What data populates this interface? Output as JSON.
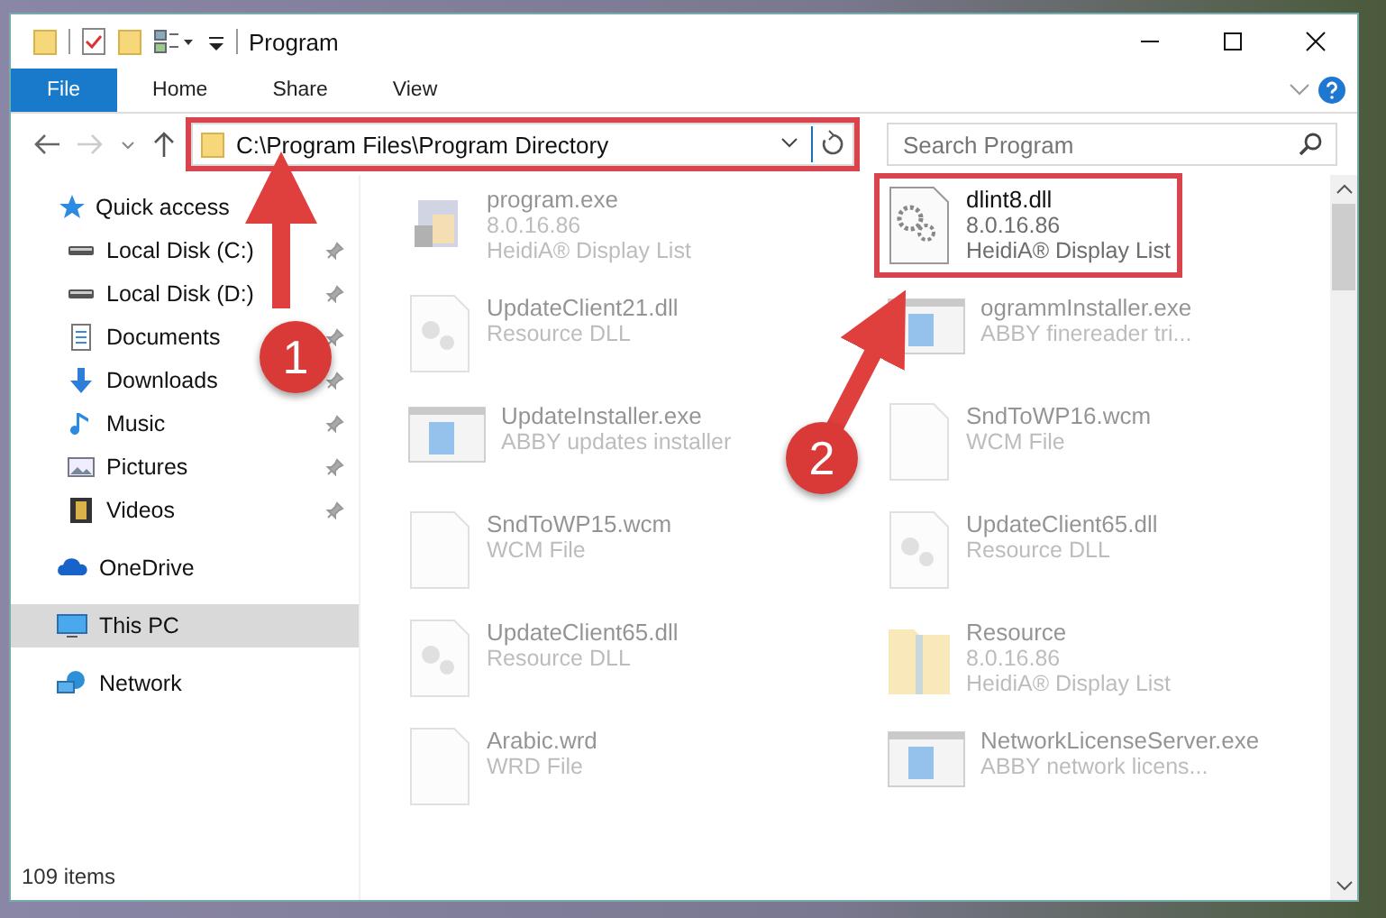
{
  "window": {
    "title": "Program"
  },
  "ribbon_tabs": [
    {
      "label": "File",
      "selected": true
    },
    {
      "label": "Home",
      "selected": false
    },
    {
      "label": "Share",
      "selected": false
    },
    {
      "label": "View",
      "selected": false
    }
  ],
  "address_bar": {
    "path": "C:\\Program Files\\Program Directory",
    "highlighted": true
  },
  "search": {
    "placeholder": "Search Program"
  },
  "sidebar": {
    "items": [
      {
        "label": "Quick access",
        "kind": "star",
        "pinned": false,
        "selected": false,
        "children": [
          {
            "label": "Local Disk (C:)",
            "kind": "drive",
            "pinned": true,
            "selected": false
          },
          {
            "label": "Local Disk (D:)",
            "kind": "drive",
            "pinned": true,
            "selected": false
          },
          {
            "label": "Documents",
            "kind": "document",
            "pinned": true,
            "selected": false
          },
          {
            "label": "Downloads",
            "kind": "download",
            "pinned": true,
            "selected": false
          },
          {
            "label": "Music",
            "kind": "music",
            "pinned": true,
            "selected": false
          },
          {
            "label": "Pictures",
            "kind": "picture",
            "pinned": true,
            "selected": false
          },
          {
            "label": "Videos",
            "kind": "video",
            "pinned": true,
            "selected": false
          }
        ]
      },
      {
        "label": "OneDrive",
        "kind": "cloud",
        "pinned": false,
        "selected": false
      },
      {
        "label": "This PC",
        "kind": "pc",
        "pinned": false,
        "selected": true
      },
      {
        "label": "Network",
        "kind": "network",
        "pinned": false,
        "selected": false
      }
    ]
  },
  "files": [
    {
      "name": "program.exe",
      "details": [
        "8.0.16.86",
        "HeidiA® Display List"
      ],
      "kind": "installer",
      "blurred": true,
      "highlighted": false
    },
    {
      "name": "dlint8.dll",
      "details": [
        "8.0.16.86",
        "HeidiA® Display List"
      ],
      "kind": "gears",
      "blurred": false,
      "highlighted": true
    },
    {
      "name": "UpdateClient21.dll",
      "details": [
        "Resource DLL"
      ],
      "kind": "dll",
      "blurred": true,
      "highlighted": false
    },
    {
      "name": "ogrammInstaller.exe",
      "details": [
        "ABBY finereader tri..."
      ],
      "kind": "window",
      "blurred": true,
      "highlighted": false
    },
    {
      "name": "UpdateInstaller.exe",
      "details": [
        "ABBY updates installer"
      ],
      "kind": "window",
      "blurred": true,
      "highlighted": false
    },
    {
      "name": "SndToWP16.wcm",
      "details": [
        "WCM File"
      ],
      "kind": "blank",
      "blurred": true,
      "highlighted": false
    },
    {
      "name": "SndToWP15.wcm",
      "details": [
        "WCM File"
      ],
      "kind": "blank",
      "blurred": true,
      "highlighted": false
    },
    {
      "name": "UpdateClient65.dll",
      "details": [
        "Resource DLL"
      ],
      "kind": "dll",
      "blurred": true,
      "highlighted": false
    },
    {
      "name": "UpdateClient65.dll",
      "details": [
        "Resource DLL"
      ],
      "kind": "dll",
      "blurred": true,
      "highlighted": false
    },
    {
      "name": "Resource",
      "details": [
        "8.0.16.86",
        "HeidiA® Display List"
      ],
      "kind": "folder",
      "blurred": true,
      "highlighted": false
    },
    {
      "name": "Arabic.wrd",
      "details": [
        "WRD File"
      ],
      "kind": "blank",
      "blurred": true,
      "highlighted": false
    },
    {
      "name": "NetworkLicenseServer.exe",
      "details": [
        "ABBY network licens..."
      ],
      "kind": "window",
      "blurred": true,
      "highlighted": false
    }
  ],
  "status_bar": {
    "item_count": "109 items"
  },
  "annotations": [
    {
      "number": "1"
    },
    {
      "number": "2"
    }
  ]
}
